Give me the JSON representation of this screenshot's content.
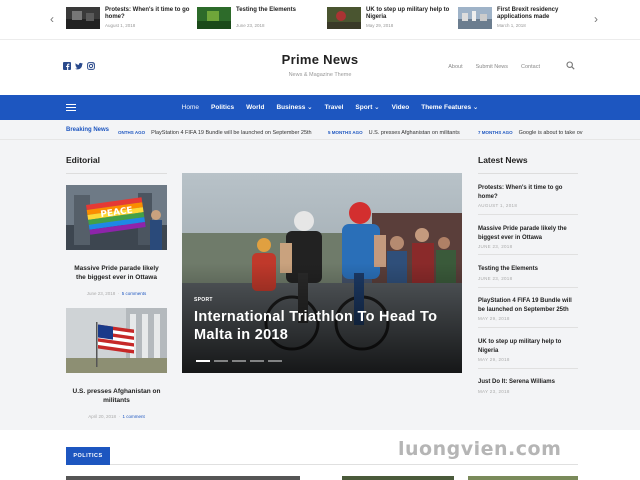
{
  "top_carousel": {
    "items": [
      {
        "title": "Protests: When's it time to go home?",
        "date": "August 1, 2018"
      },
      {
        "title": "Testing the Elements",
        "date": "June 23, 2018"
      },
      {
        "title": "UK to step up military help to Nigeria",
        "date": "May 29, 2018"
      },
      {
        "title": "First Brexit residency applications made",
        "date": "March 1, 2018"
      }
    ],
    "prev_icon": "‹",
    "next_icon": "›"
  },
  "header": {
    "site_title": "Prime News",
    "tagline": "News & Magazine Theme",
    "social_icons": [
      "facebook-icon",
      "twitter-icon",
      "instagram-icon"
    ],
    "links": [
      "About",
      "Submit News",
      "Contact"
    ]
  },
  "nav": {
    "items": [
      {
        "label": "Home"
      },
      {
        "label": "Politics"
      },
      {
        "label": "World"
      },
      {
        "label": "Business ⌄"
      },
      {
        "label": "Travel"
      },
      {
        "label": "Sport ⌄"
      },
      {
        "label": "Video"
      },
      {
        "label": "Theme Features ⌄"
      }
    ]
  },
  "breaking": {
    "label": "Breaking News",
    "items": [
      {
        "ago": "ONTHS AGO",
        "text": "PlayStation 4 FIFA 19 Bundle will be launched on September 25th"
      },
      {
        "ago": "5 MONTHS AGO",
        "text": "U.S. presses Afghanistan on militants"
      },
      {
        "ago": "7 MONTHS AGO",
        "text": "Google is about to take ov"
      }
    ]
  },
  "editorial": {
    "title": "Editorial",
    "cards": [
      {
        "title": "Massive Pride parade likely the biggest ever in Ottawa",
        "date": "June 23, 2018",
        "comments": "5 comments"
      },
      {
        "title": "U.S. presses Afghanistan on militants",
        "date": "April 20, 2018",
        "comments": "1 comment"
      }
    ]
  },
  "hero": {
    "category": "SPORT",
    "title": "International Triathlon To Head To Malta in 2018",
    "active_slide": 1,
    "slide_count": 5
  },
  "latest": {
    "title": "Latest News",
    "items": [
      {
        "title": "Protests: When's it time to go home?",
        "date": "AUGUST 1, 2018"
      },
      {
        "title": "Massive Pride parade likely the biggest ever in Ottawa",
        "date": "JUNE 23, 2018"
      },
      {
        "title": "Testing the Elements",
        "date": "JUNE 23, 2018"
      },
      {
        "title": "PlayStation 4 FIFA 19 Bundle will be launched on September 25th",
        "date": "MAY 29, 2018"
      },
      {
        "title": "UK to step up military help to Nigeria",
        "date": "MAY 29, 2018"
      },
      {
        "title": "Just Do It: Serena Williams",
        "date": "MAY 23, 2018"
      }
    ]
  },
  "politics": {
    "label": "POLITICS"
  },
  "watermark": "luongvien.com",
  "colors": {
    "accent": "#1d56c0",
    "background": "#f3f4f6"
  }
}
